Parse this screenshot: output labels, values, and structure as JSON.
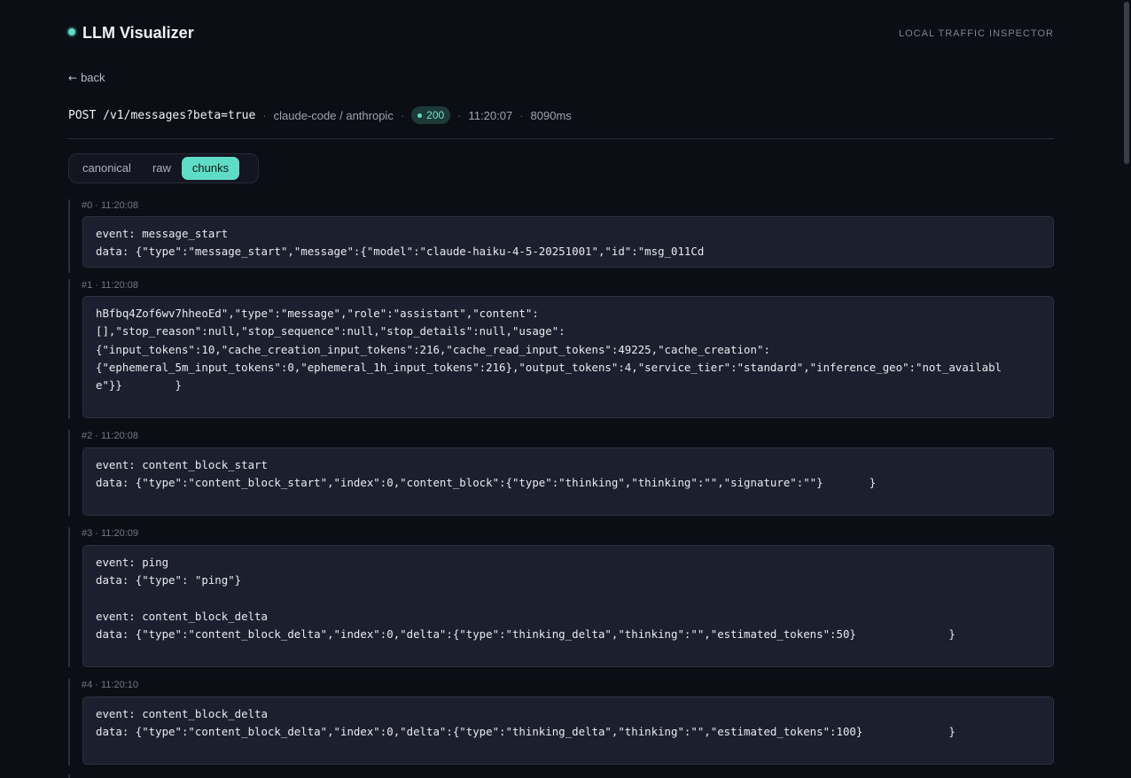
{
  "app": {
    "title": "LLM Visualizer",
    "tagline": "LOCAL TRAFFIC INSPECTOR"
  },
  "nav": {
    "back_label": "back"
  },
  "request": {
    "method_path": "POST /v1/messages?beta=true",
    "client": "claude-code / anthropic",
    "status": "200",
    "time": "11:20:07",
    "duration": "8090ms"
  },
  "tabs": [
    {
      "label": "canonical",
      "active": false
    },
    {
      "label": "raw",
      "active": false
    },
    {
      "label": "chunks",
      "active": true
    }
  ],
  "chunks": [
    {
      "meta": "#0 · 11:20:08",
      "text": "event: message_start\ndata: {\"type\":\"message_start\",\"message\":{\"model\":\"claude-haiku-4-5-20251001\",\"id\":\"msg_011Cd"
    },
    {
      "meta": "#1 · 11:20:08",
      "text": "hBfbq4Zof6wv7hheoEd\",\"type\":\"message\",\"role\":\"assistant\",\"content\":\n[],\"stop_reason\":null,\"stop_sequence\":null,\"stop_details\":null,\"usage\":\n{\"input_tokens\":10,\"cache_creation_input_tokens\":216,\"cache_read_input_tokens\":49225,\"cache_creation\":\n{\"ephemeral_5m_input_tokens\":0,\"ephemeral_1h_input_tokens\":216},\"output_tokens\":4,\"service_tier\":\"standard\",\"inference_geo\":\"not_availabl\ne\"}}        }"
    },
    {
      "meta": "#2 · 11:20:08",
      "text": "event: content_block_start\ndata: {\"type\":\"content_block_start\",\"index\":0,\"content_block\":{\"type\":\"thinking\",\"thinking\":\"\",\"signature\":\"\"}       }"
    },
    {
      "meta": "#3 · 11:20:09",
      "text": "event: ping\ndata: {\"type\": \"ping\"}\n\nevent: content_block_delta\ndata: {\"type\":\"content_block_delta\",\"index\":0,\"delta\":{\"type\":\"thinking_delta\",\"thinking\":\"\",\"estimated_tokens\":50}              }"
    },
    {
      "meta": "#4 · 11:20:10",
      "text": "event: content_block_delta\ndata: {\"type\":\"content_block_delta\",\"index\":0,\"delta\":{\"type\":\"thinking_delta\",\"thinking\":\"\",\"estimated_tokens\":100}             }"
    }
  ]
}
